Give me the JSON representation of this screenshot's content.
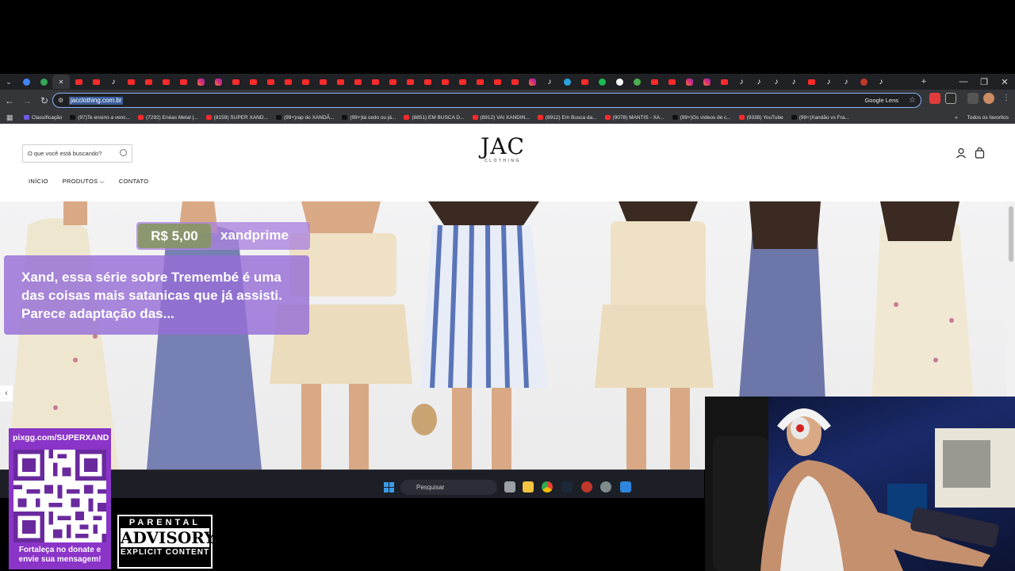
{
  "browser": {
    "url": "jacclothing.com.br",
    "google_lens_label": "Google Lens",
    "bookmarks": [
      {
        "label": "Classificação",
        "color": "#6c5ce7"
      },
      {
        "label": "(97)Te ensino a venc...",
        "color": "#111111"
      },
      {
        "label": "(7292) Enéas Metal |...",
        "color": "#ff2b2b"
      },
      {
        "label": "(8159) SUPER XAND...",
        "color": "#ff2b2b"
      },
      {
        "label": "(99+)rap do XANDÃ...",
        "color": "#111111"
      },
      {
        "label": "(99+)tá cedo ou já...",
        "color": "#111111"
      },
      {
        "label": "(8851) EM BUSCA D...",
        "color": "#ff2b2b"
      },
      {
        "label": "(8912) VAI XANDIN...",
        "color": "#ff2b2b"
      },
      {
        "label": "(8912) Em Busca da...",
        "color": "#ff2b2b"
      },
      {
        "label": "(9078) MANTIS - XA...",
        "color": "#ff2b2b"
      },
      {
        "label": "(99+)Os vídeos de c...",
        "color": "#111111"
      },
      {
        "label": "(9338) YouTube",
        "color": "#ff2b2b"
      },
      {
        "label": "(99+)Xandão vs Fra...",
        "color": "#111111"
      }
    ],
    "all_bookmarks_label": "Todos os favoritos"
  },
  "site": {
    "search_placeholder": "O que você está buscando?",
    "logo_main": "JAC",
    "logo_sub": "CLOTHING",
    "nav": [
      "INÍCIO",
      "PRODUTOS",
      "CONTATO"
    ]
  },
  "donation": {
    "amount": "R$ 5,00",
    "user": "xandprime",
    "message": "Xand, essa série sobre Tremembé é uma das coisas mais satanicas que já assisti. Parece adaptação das..."
  },
  "taskbar": {
    "search_label": "Pesquisar"
  },
  "qr": {
    "site": "pixgg.com/SUPERXAND",
    "caption": "Fortaleça no donate e envie sua mensagem!"
  },
  "advisory": {
    "line1": "PARENTAL",
    "line2": "ADVISORY",
    "line3": "EXPLICIT CONTENT"
  },
  "colors": {
    "accent": "#8ab4f8",
    "donation_purple": "#966ed7",
    "donation_green": "#82965a",
    "qr_purple": "#8a34c8"
  }
}
